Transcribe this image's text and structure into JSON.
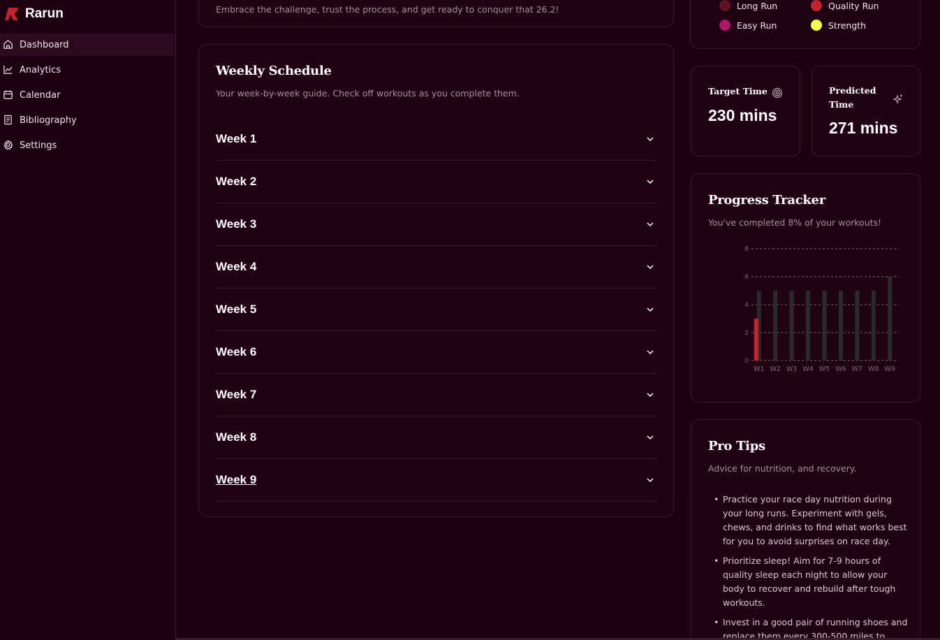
{
  "app": {
    "name": "Rarun"
  },
  "sidebar": {
    "items": [
      {
        "label": "Dashboard",
        "icon": "home-icon",
        "active": true
      },
      {
        "label": "Analytics",
        "icon": "line-chart-icon",
        "active": false
      },
      {
        "label": "Calendar",
        "icon": "calendar-icon",
        "active": false
      },
      {
        "label": "Bibliography",
        "icon": "book-icon",
        "active": false
      },
      {
        "label": "Settings",
        "icon": "gear-icon",
        "active": false
      }
    ]
  },
  "intro": {
    "text": "Embrace the challenge, trust the process, and get ready to conquer that 26.2!"
  },
  "schedule": {
    "title": "Weekly Schedule",
    "subtitle": "Your week-by-week guide. Check off workouts as you complete them.",
    "weeks": [
      "Week 1",
      "Week 2",
      "Week 3",
      "Week 4",
      "Week 5",
      "Week 6",
      "Week 7",
      "Week 8",
      "Week 9"
    ]
  },
  "legend": {
    "items": [
      {
        "label": "Long Run",
        "color": "#5e1422"
      },
      {
        "label": "Quality Run",
        "color": "#c1242f"
      },
      {
        "label": "Easy Run",
        "color": "#b0176a"
      },
      {
        "label": "Strength",
        "color": "#f3ff4d"
      }
    ]
  },
  "stats": {
    "target": {
      "label": "Target Time",
      "value": "230 mins",
      "icon": "target-icon"
    },
    "predicted": {
      "label_line1": "Predicted",
      "label_line2": "Time",
      "value": "271 mins",
      "icon": "sparkles-icon"
    }
  },
  "progress": {
    "title": "Progress Tracker",
    "subtitle": "You've completed 8% of your workouts!"
  },
  "chart_data": {
    "type": "bar",
    "categories": [
      "W1",
      "W2",
      "W3",
      "W4",
      "W5",
      "W6",
      "W7",
      "W8",
      "W9"
    ],
    "series": [
      {
        "values": [
          5,
          5,
          5,
          5,
          5,
          5,
          5,
          5,
          6
        ],
        "color": "#2a2a2a"
      },
      {
        "values": [
          3,
          0,
          0,
          0,
          0,
          0,
          0,
          0,
          0
        ],
        "color": "#c1242f"
      }
    ],
    "yticks": [
      0,
      2,
      4,
      6,
      8
    ],
    "ylim": [
      0,
      8
    ],
    "grid": true
  },
  "tips": {
    "title": "Pro Tips",
    "subtitle": "Advice for nutrition, and recovery.",
    "items": [
      "Practice your race day nutrition during your long runs. Experiment with gels, chews, and drinks to find what works best for you to avoid surprises on race day.",
      "Prioritize sleep! Aim for 7-9 hours of quality sleep each night to allow your body to recover and rebuild after tough workouts.",
      "Invest in a good pair of running shoes and replace them every 300-500 miles to"
    ]
  }
}
